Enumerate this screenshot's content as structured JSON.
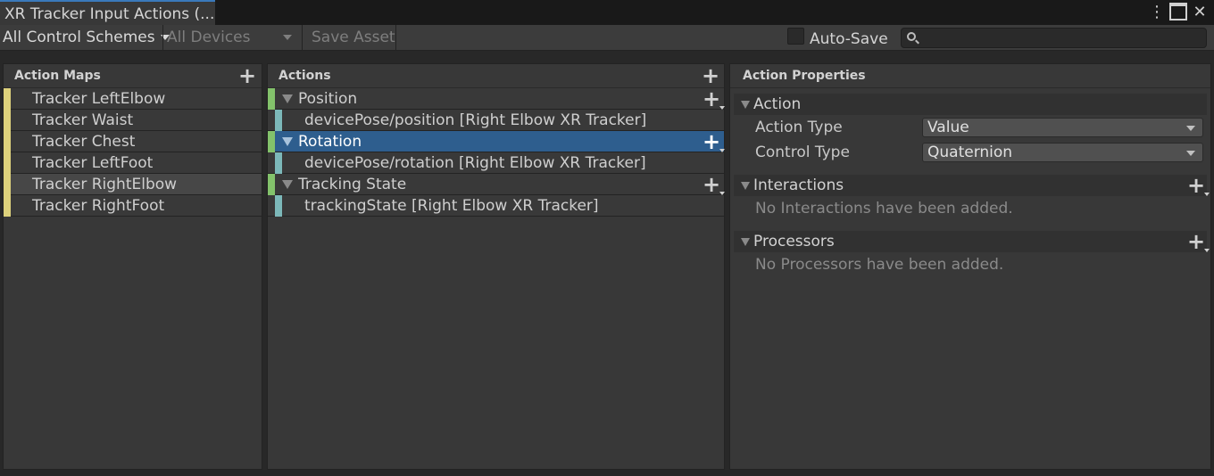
{
  "window": {
    "tab_title": "XR Tracker Input Actions (...",
    "icons": [
      "more-vert-icon",
      "maximize-icon",
      "close-icon"
    ]
  },
  "toolbar": {
    "control_schemes": "All Control Schemes",
    "devices": "All Devices",
    "save_asset": "Save Asset",
    "auto_save": "Auto-Save",
    "search_value": ""
  },
  "action_maps": {
    "header": "Action Maps",
    "items": [
      {
        "label": "Tracker LeftElbow"
      },
      {
        "label": "Tracker Waist"
      },
      {
        "label": "Tracker Chest"
      },
      {
        "label": "Tracker LeftFoot"
      },
      {
        "label": "Tracker RightElbow",
        "selected": true
      },
      {
        "label": "Tracker RightFoot"
      }
    ]
  },
  "actions": {
    "header": "Actions",
    "items": [
      {
        "label": "Position",
        "binding": "devicePose/position [Right Elbow XR Tracker]"
      },
      {
        "label": "Rotation",
        "binding": "devicePose/rotation [Right Elbow XR Tracker]",
        "selected": true
      },
      {
        "label": "Tracking State",
        "binding": "trackingState [Right Elbow XR Tracker]"
      }
    ]
  },
  "properties": {
    "header": "Action Properties",
    "action_section": "Action",
    "action_type_label": "Action Type",
    "action_type_value": "Value",
    "control_type_label": "Control Type",
    "control_type_value": "Quaternion",
    "interactions_section": "Interactions",
    "interactions_empty": "No Interactions have been added.",
    "processors_section": "Processors",
    "processors_empty": "No Processors have been added."
  },
  "colors": {
    "selection": "#2e5e8e",
    "map_marker": "#ddd17c",
    "action_marker": "#83c26b",
    "binding_marker": "#7cb8b9"
  }
}
